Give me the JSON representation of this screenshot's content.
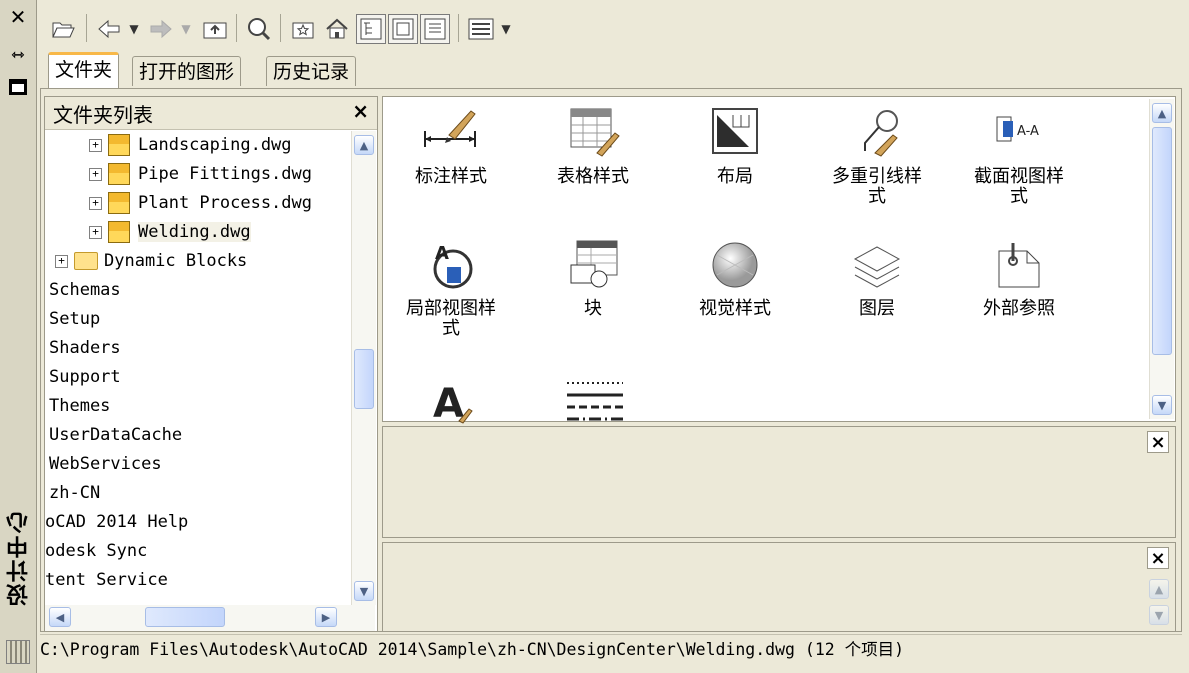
{
  "window": {
    "title": "设计中心",
    "close_glyph": "✕"
  },
  "toolbar": {
    "buttons": [
      "open-icon",
      "back-icon",
      "forward-icon",
      "up-icon",
      "search-icon",
      "favorites-icon",
      "home-icon",
      "tree-view-toggle-icon",
      "preview-icon",
      "description-icon",
      "views-icon"
    ]
  },
  "tabs": [
    {
      "label": "文件夹",
      "active": true
    },
    {
      "label": "打开的图形",
      "active": false
    },
    {
      "label": "历史记录",
      "active": false
    }
  ],
  "folder_panel": {
    "title": "文件夹列表",
    "close": "×",
    "tree": [
      {
        "label": "Landscaping.dwg",
        "type": "dwg"
      },
      {
        "label": "Pipe Fittings.dwg",
        "type": "dwg"
      },
      {
        "label": "Plant Process.dwg",
        "type": "dwg"
      },
      {
        "label": "Welding.dwg",
        "type": "dwg",
        "selected": true
      },
      {
        "label": "Dynamic Blocks",
        "type": "folder"
      },
      {
        "label": "Schemas",
        "type": "plain"
      },
      {
        "label": "Setup",
        "type": "plain"
      },
      {
        "label": "Shaders",
        "type": "plain"
      },
      {
        "label": "Support",
        "type": "plain"
      },
      {
        "label": "Themes",
        "type": "plain"
      },
      {
        "label": "UserDataCache",
        "type": "plain"
      },
      {
        "label": "WebServices",
        "type": "plain"
      },
      {
        "label": "zh-CN",
        "type": "plain"
      },
      {
        "label": "oCAD 2014 Help",
        "type": "plain"
      },
      {
        "label": "odesk Sync",
        "type": "plain"
      },
      {
        "label": "tent Service",
        "type": "plain"
      }
    ]
  },
  "content": {
    "items": [
      {
        "label": "标注样式",
        "icon": "dimension-style-icon"
      },
      {
        "label": "表格样式",
        "icon": "table-style-icon"
      },
      {
        "label": "布局",
        "icon": "layout-icon"
      },
      {
        "label": "多重引线样\n式",
        "icon": "multileader-style-icon"
      },
      {
        "label": "截面视图样\n式",
        "icon": "section-view-style-icon"
      },
      {
        "label": "局部视图样\n式",
        "icon": "detail-view-style-icon"
      },
      {
        "label": "块",
        "icon": "block-icon"
      },
      {
        "label": "视觉样式",
        "icon": "visual-style-icon"
      },
      {
        "label": "图层",
        "icon": "layers-icon"
      },
      {
        "label": "外部参照",
        "icon": "xref-icon"
      },
      {
        "label": "",
        "icon": "text-style-icon"
      },
      {
        "label": "",
        "icon": "linetype-icon"
      }
    ]
  },
  "panes": {
    "preview_close": "×",
    "description_close": "×"
  },
  "status": {
    "path": "C:\\Program Files\\Autodesk\\AutoCAD 2014\\Sample\\zh-CN\\DesignCenter\\Welding.dwg (12 个项目)"
  },
  "colors": {
    "background": "#ece9d8",
    "tab_accent": "#f8b848",
    "scroll_blue": "#c3d5fb"
  }
}
